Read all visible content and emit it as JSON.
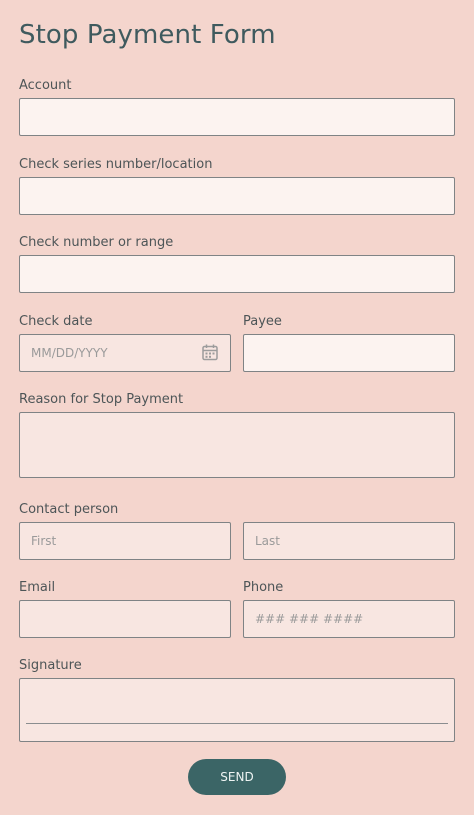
{
  "form": {
    "title": "Stop Payment Form",
    "account": {
      "label": "Account",
      "value": ""
    },
    "check_series": {
      "label": "Check series number/location",
      "value": ""
    },
    "check_number": {
      "label": "Check number or range",
      "value": ""
    },
    "check_date": {
      "label": "Check date",
      "placeholder": "MM/DD/YYYY",
      "icon": "calendar-icon"
    },
    "payee": {
      "label": "Payee",
      "value": ""
    },
    "reason": {
      "label": "Reason for Stop Payment",
      "value": ""
    },
    "contact": {
      "label": "Contact person",
      "first_placeholder": "First",
      "last_placeholder": "Last"
    },
    "email": {
      "label": "Email",
      "value": ""
    },
    "phone": {
      "label": "Phone",
      "placeholder": "### ### ####"
    },
    "signature": {
      "label": "Signature"
    },
    "send_label": "SEND"
  },
  "colors": {
    "background": "#f4d5cd",
    "field_light": "#fcf3f0",
    "field_tinted": "#f8e6e1",
    "accent": "#3b6566"
  }
}
